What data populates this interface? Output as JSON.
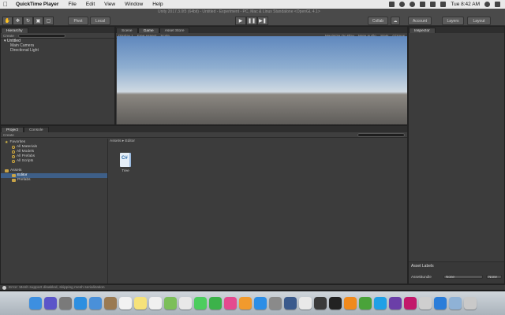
{
  "menubar": {
    "app_name": "QuickTime Player",
    "items": [
      "File",
      "Edit",
      "View",
      "Window",
      "Help"
    ],
    "clock": "Tue 8:42 AM"
  },
  "window": {
    "title": "Unity 2017.3.0f3 (64bit) - Untitled - Experiment - PC, Mac & Linux Standalone <OpenGL 4.1>"
  },
  "toolbar": {
    "pivot_label": "Pivot",
    "local_label": "Local",
    "collab_label": "Collab",
    "account_label": "Account",
    "layers_label": "Layers",
    "layout_label": "Layout"
  },
  "hierarchy": {
    "tab_label": "Hierarchy",
    "create_label": "Create",
    "scene_name": "Untitled",
    "items": [
      "Main Camera",
      "Directional Light"
    ]
  },
  "scene_tabs": {
    "scene": "Scene",
    "game": "Game",
    "asset_store": "Asset Store",
    "display": "Display 1",
    "aspect": "Free Aspect",
    "scale_label": "Scale",
    "maximize": "Maximize On Play",
    "mute": "Mute Audio",
    "stats": "Stats",
    "gizmos": "Gizmos"
  },
  "project": {
    "project_tab": "Project",
    "console_tab": "Console",
    "create_label": "Create",
    "breadcrumb_root": "Assets",
    "breadcrumb_current": "Editor",
    "favorites_label": "Favorites",
    "favorites": [
      "All Materials",
      "All Models",
      "All Prefabs",
      "All Scripts"
    ],
    "assets_label": "Assets",
    "asset_folders": [
      "Editor",
      "Prefabs"
    ],
    "files": [
      {
        "name": "Tree"
      }
    ]
  },
  "inspector": {
    "tab_label": "Inspector",
    "asset_labels": "Asset Labels",
    "asset_bundle": "AssetBundle",
    "bundle_value": "None",
    "variant_value": "None"
  },
  "status": {
    "message": "Error: Mesh support disabled, skipping mesh serialization"
  },
  "dock_apps": [
    {
      "name": "finder",
      "color": "#3d8fe0"
    },
    {
      "name": "siri",
      "color": "#5b55c9"
    },
    {
      "name": "launchpad",
      "color": "#7a7a7a"
    },
    {
      "name": "safari",
      "color": "#2d8fe0"
    },
    {
      "name": "mail",
      "color": "#4a90d9"
    },
    {
      "name": "contacts",
      "color": "#9a7a52"
    },
    {
      "name": "calendar",
      "color": "#f2f2f2"
    },
    {
      "name": "notes",
      "color": "#f6e27a"
    },
    {
      "name": "reminders",
      "color": "#f0f0f0"
    },
    {
      "name": "maps",
      "color": "#7cbf5a"
    },
    {
      "name": "photos",
      "color": "#e8e8e8"
    },
    {
      "name": "messages",
      "color": "#4ccd5e"
    },
    {
      "name": "facetime",
      "color": "#3cb24a"
    },
    {
      "name": "itunes",
      "color": "#e44a8f"
    },
    {
      "name": "ibooks",
      "color": "#f19a2d"
    },
    {
      "name": "app-store",
      "color": "#2c8ee6"
    },
    {
      "name": "system-preferences",
      "color": "#8a8a8a"
    },
    {
      "name": "quicktime",
      "color": "#3a5a8c"
    },
    {
      "name": "chrome",
      "color": "#e9e9e9"
    },
    {
      "name": "unity",
      "color": "#3a3a3a"
    },
    {
      "name": "terminal",
      "color": "#222222"
    },
    {
      "name": "vlc",
      "color": "#f08a1d"
    },
    {
      "name": "xbox",
      "color": "#4aa33a"
    },
    {
      "name": "skype",
      "color": "#1fa0e6"
    },
    {
      "name": "visual-studio",
      "color": "#6b3fa8"
    },
    {
      "name": "rider",
      "color": "#c2186b"
    },
    {
      "name": "unity-hub",
      "color": "#cfcfcf"
    },
    {
      "name": "git-client",
      "color": "#2a7dd9"
    },
    {
      "name": "downloads",
      "color": "#8fb2d6"
    },
    {
      "name": "trash",
      "color": "#c9c9c9"
    }
  ]
}
